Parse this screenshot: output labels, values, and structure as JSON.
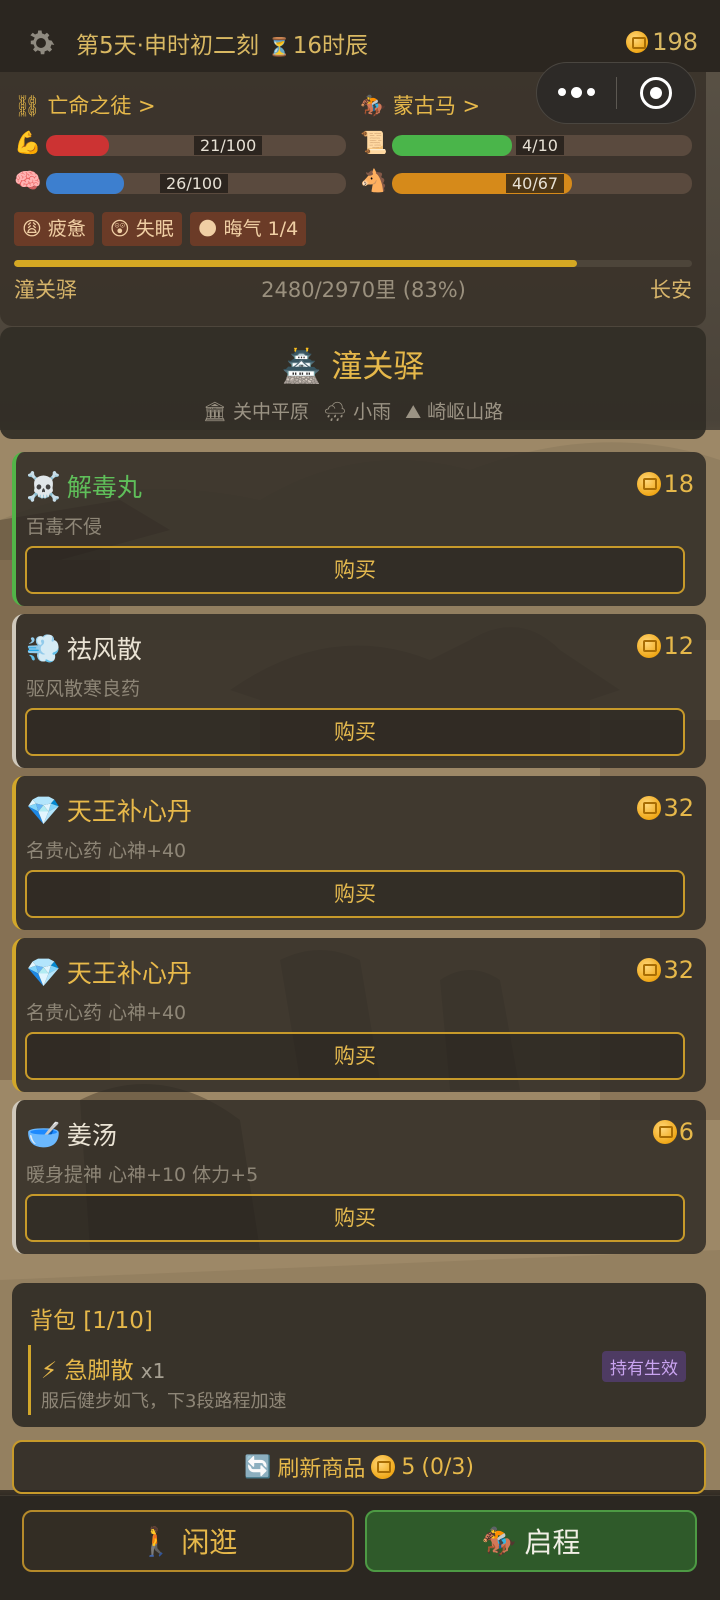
{
  "topbar": {
    "icon": "gear-icon",
    "day": "第5天",
    "dot": "·",
    "time": "申时初二刻",
    "hourglass": "⏳",
    "hours": "16时辰",
    "gold": "198"
  },
  "capsule": {
    "more_icon": "more-dots-icon",
    "record_icon": "record-icon"
  },
  "status": {
    "identity": "⛓ 亡命之徒 >",
    "horse": "🏇 蒙古马 >",
    "bars": [
      {
        "icon": "💪",
        "value": "21/100",
        "fraction": 0.21,
        "color": "#cc3333"
      },
      {
        "icon": "🧠",
        "value": "26/100",
        "fraction": 0.26,
        "color": "#3d7fcf"
      },
      {
        "icon": "📜",
        "value": "4/10",
        "fraction": 0.4,
        "color": "#4ab54a"
      },
      {
        "icon": "🐴",
        "value": "40/67",
        "fraction": 0.6,
        "color": "#d68a1a"
      }
    ],
    "tags": [
      "😩 疲惫",
      "😲 失眠",
      "🌑 晦气 1/4"
    ],
    "progress_fraction": 0.83,
    "route_from": "潼关驿",
    "route_progress": "2480/2970里 (83%)",
    "route_to": "长安"
  },
  "station": {
    "icon": "🏯",
    "name": "潼关驿",
    "region": "🏛 关中平原",
    "weather": "🌧 小雨",
    "road": "⛰ 崎岖山路"
  },
  "shop": {
    "items": [
      {
        "emoji": "☠️",
        "name": "解毒丸",
        "price": "18",
        "desc": "百毒不侵",
        "buy": "购买",
        "rarity": "green"
      },
      {
        "emoji": "💨",
        "name": "祛风散",
        "price": "12",
        "desc": "驱风散寒良药",
        "buy": "购买",
        "rarity": "white"
      },
      {
        "emoji": "💎",
        "name": "天王补心丹",
        "price": "32",
        "desc": "名贵心药  心神+40",
        "buy": "购买",
        "rarity": "gold"
      },
      {
        "emoji": "💎",
        "name": "天王补心丹",
        "price": "32",
        "desc": "名贵心药  心神+40",
        "buy": "购买",
        "rarity": "gold"
      },
      {
        "emoji": "🥣",
        "name": "姜汤",
        "price": "6",
        "desc": "暖身提神  心神+10 体力+5",
        "buy": "购买",
        "rarity": "white"
      }
    ]
  },
  "bag": {
    "title": "背包 [1/10]",
    "item": {
      "emoji": "⚡",
      "name": "急脚散",
      "qty": "x1",
      "badge": "持有生效",
      "desc": "服后健步如飞，下3段路程加速"
    }
  },
  "refresh": {
    "icon": "🔄",
    "label": "刷新商品",
    "cost": "5",
    "count": "(0/3)"
  },
  "footer": {
    "wander_icon": "🚶",
    "wander": "闲逛",
    "go_icon": "🏇",
    "go": "启程"
  },
  "colors": {
    "accent": "#e6b84a",
    "panel": "#3a332a",
    "green": "#52b548"
  }
}
